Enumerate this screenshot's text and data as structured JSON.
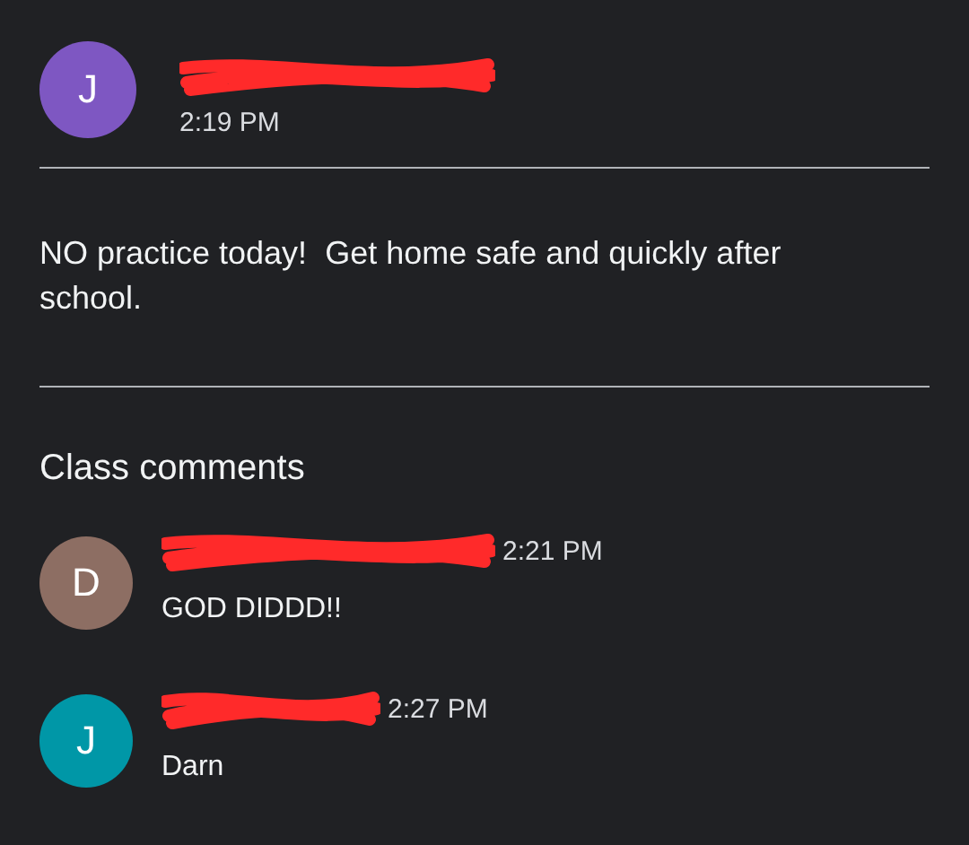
{
  "post": {
    "author": {
      "initial": "J",
      "color": "#7e57c2",
      "redacted": true
    },
    "time": "2:19 PM",
    "body": "NO practice today!  Get home safe and quickly after school."
  },
  "comments_heading": "Class comments",
  "comments": [
    {
      "initial": "D",
      "color": "#8d6e63",
      "redacted": true,
      "time": "2:21 PM",
      "text": "GOD DIDDD!!"
    },
    {
      "initial": "J",
      "color": "#0097a7",
      "redacted": true,
      "time": "2:27 PM",
      "text": "Darn"
    }
  ]
}
